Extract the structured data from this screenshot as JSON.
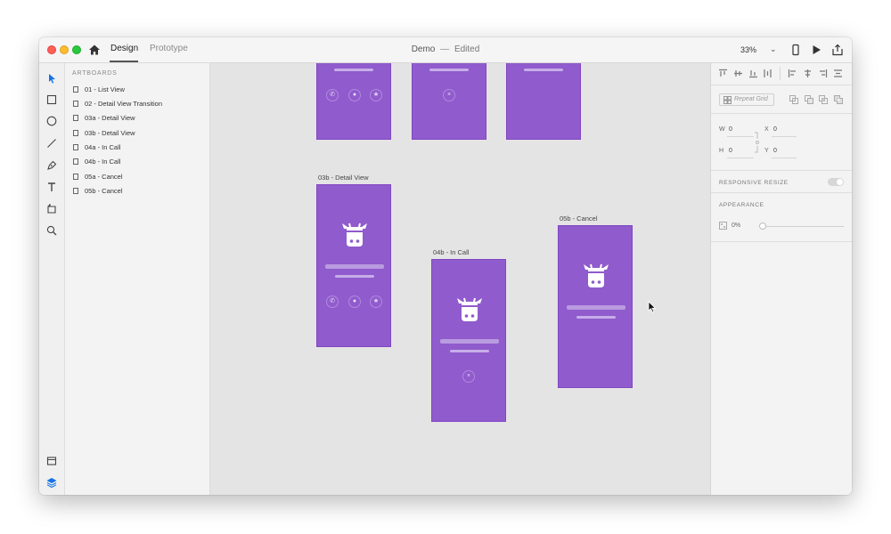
{
  "window": {
    "title": "Demo",
    "separator": "—",
    "state": "Edited",
    "tabs": {
      "design": "Design",
      "prototype": "Prototype"
    },
    "zoom": "33%"
  },
  "layers": {
    "header": "ARTBOARDS",
    "items": [
      "01 - List View",
      "02 - Detail View Transition",
      "03a - Detail View",
      "03b - Detail View",
      "04a - In Call",
      "04b - In Call",
      "05a - Cancel",
      "05b - Cancel"
    ]
  },
  "canvas": {
    "artboards": {
      "detail_view_03b": "03b - Detail View",
      "in_call_04b": "04b - In Call",
      "cancel_05b": "05b - Cancel"
    },
    "artboard_color": "#905bcd"
  },
  "properties": {
    "repeat_grid": "Repeat Grid",
    "w_label": "W",
    "w_value": "0",
    "x_label": "X",
    "x_value": "0",
    "h_label": "H",
    "h_value": "0",
    "y_label": "Y",
    "y_value": "0",
    "responsive_resize": "RESPONSIVE RESIZE",
    "appearance": "APPEARANCE",
    "opacity": "0%"
  },
  "icons": {
    "toolbar": [
      "select-icon",
      "rectangle-icon",
      "ellipse-icon",
      "line-icon",
      "pen-icon",
      "text-icon",
      "artboard-icon",
      "zoom-icon",
      "assets-icon",
      "layers-icon"
    ],
    "titlebar": [
      "home-icon",
      "device-preview-icon",
      "play-icon",
      "share-icon"
    ]
  }
}
